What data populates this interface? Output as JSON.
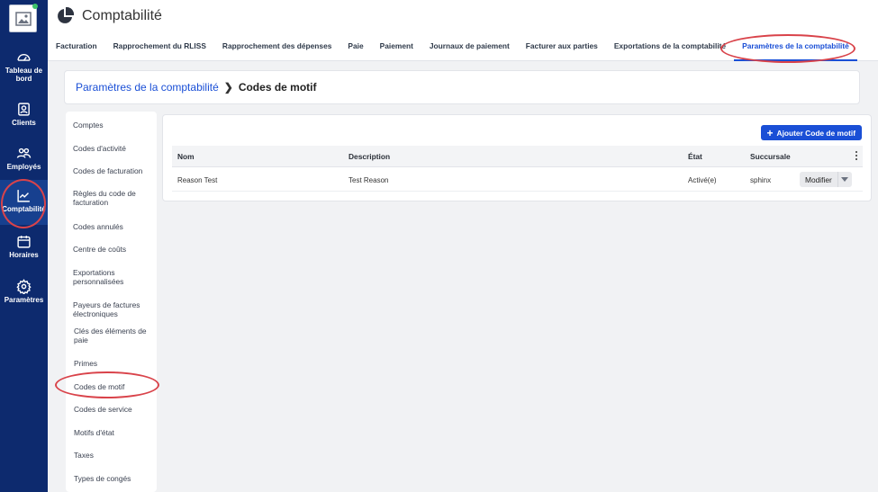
{
  "sidebar": {
    "items": [
      {
        "label": "Tableau de bord",
        "icon": "speedometer-icon"
      },
      {
        "label": "Clients",
        "icon": "contact-card-icon"
      },
      {
        "label": "Employés",
        "icon": "people-icon"
      },
      {
        "label": "Comptabilité",
        "icon": "trend-chart-icon"
      },
      {
        "label": "Horaires",
        "icon": "calendar-icon"
      },
      {
        "label": "Paramètres",
        "icon": "gear-icon"
      }
    ],
    "active": "Comptabilité"
  },
  "header": {
    "title": "Comptabilité",
    "tabs": [
      "Facturation",
      "Rapprochement du RLISS",
      "Rapprochement des dépenses",
      "Paie",
      "Paiement",
      "Journaux de paiement",
      "Facturer aux parties",
      "Exportations de la comptabilité",
      "Paramètres de la comptabilité"
    ],
    "active_tab": "Paramètres de la comptabilité"
  },
  "breadcrumb": {
    "parent": "Paramètres de la comptabilité",
    "current": "Codes de motif"
  },
  "settings_menu": {
    "items": [
      "Comptes",
      "Codes d'activité",
      "Codes de facturation",
      "Règles du code de facturation",
      "Codes annulés",
      "Centre de coûts",
      "Exportations personnalisées",
      "Payeurs de factures électroniques",
      "Clés des éléments de paie",
      "Primes",
      "Codes de motif",
      "Codes de service",
      "Motifs d'état",
      "Taxes",
      "Types de congés"
    ],
    "active": "Codes de motif"
  },
  "table": {
    "add_button_label": "Ajouter Code de motif",
    "columns": [
      "Nom",
      "Description",
      "État",
      "Succursale"
    ],
    "rows": [
      {
        "nom": "Reason Test",
        "description": "Test Reason",
        "etat": "Activé(e)",
        "succursale": "sphinx",
        "action": "Modifier"
      }
    ]
  },
  "colors": {
    "sidebar_bg": "#0d2a6e",
    "accent": "#1a4fd6",
    "annotation": "#d9434a"
  }
}
